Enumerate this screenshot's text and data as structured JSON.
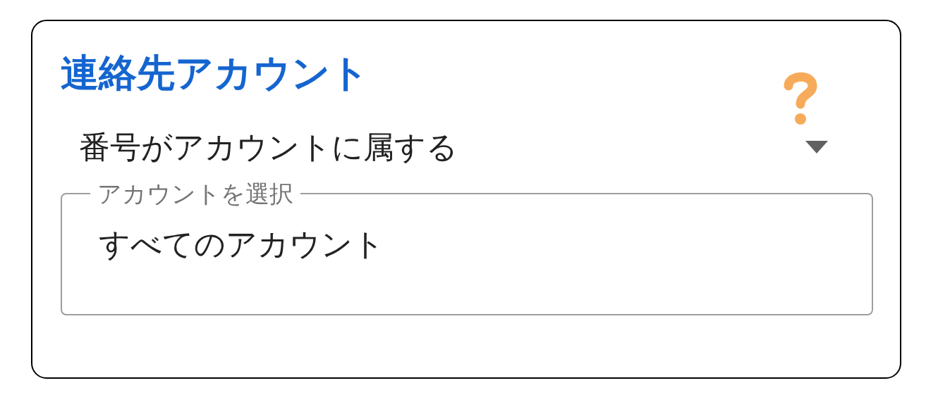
{
  "section": {
    "title": "連絡先アカウント"
  },
  "filter_dropdown": {
    "value": "番号がアカウントに属する"
  },
  "account_field": {
    "label": "アカウントを選択",
    "value": "すべてのアカウント"
  }
}
